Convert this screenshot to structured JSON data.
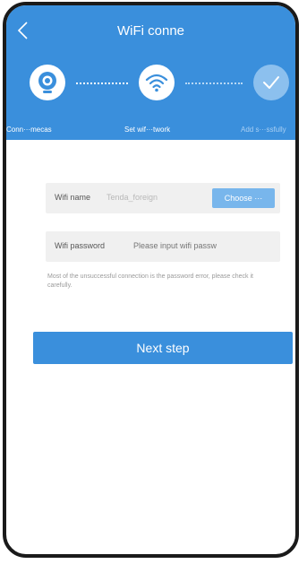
{
  "header": {
    "title": "WiFi conne",
    "back_icon": "chevron-left-icon",
    "steps": [
      {
        "label": "Conn···mecas",
        "icon": "camera-icon",
        "state": "done"
      },
      {
        "label": "Set wif···twork",
        "icon": "wifi-icon",
        "state": "active"
      },
      {
        "label": "Add s···ssfully",
        "icon": "check-icon",
        "state": "pending"
      }
    ]
  },
  "form": {
    "wifi_name_label": "Wifi name",
    "wifi_name_value": "Tenda_foreign",
    "choose_label": "Choose ···",
    "wifi_password_label": "Wifi password",
    "wifi_password_placeholder": "Please input wifi passw",
    "hint": "Most of the unsuccessful connection is the password error, please check it carefully."
  },
  "actions": {
    "next_label": "Next step"
  },
  "colors": {
    "primary": "#3a8fdc",
    "button_light": "#78b6ec",
    "field_bg": "#f0f0f0"
  }
}
